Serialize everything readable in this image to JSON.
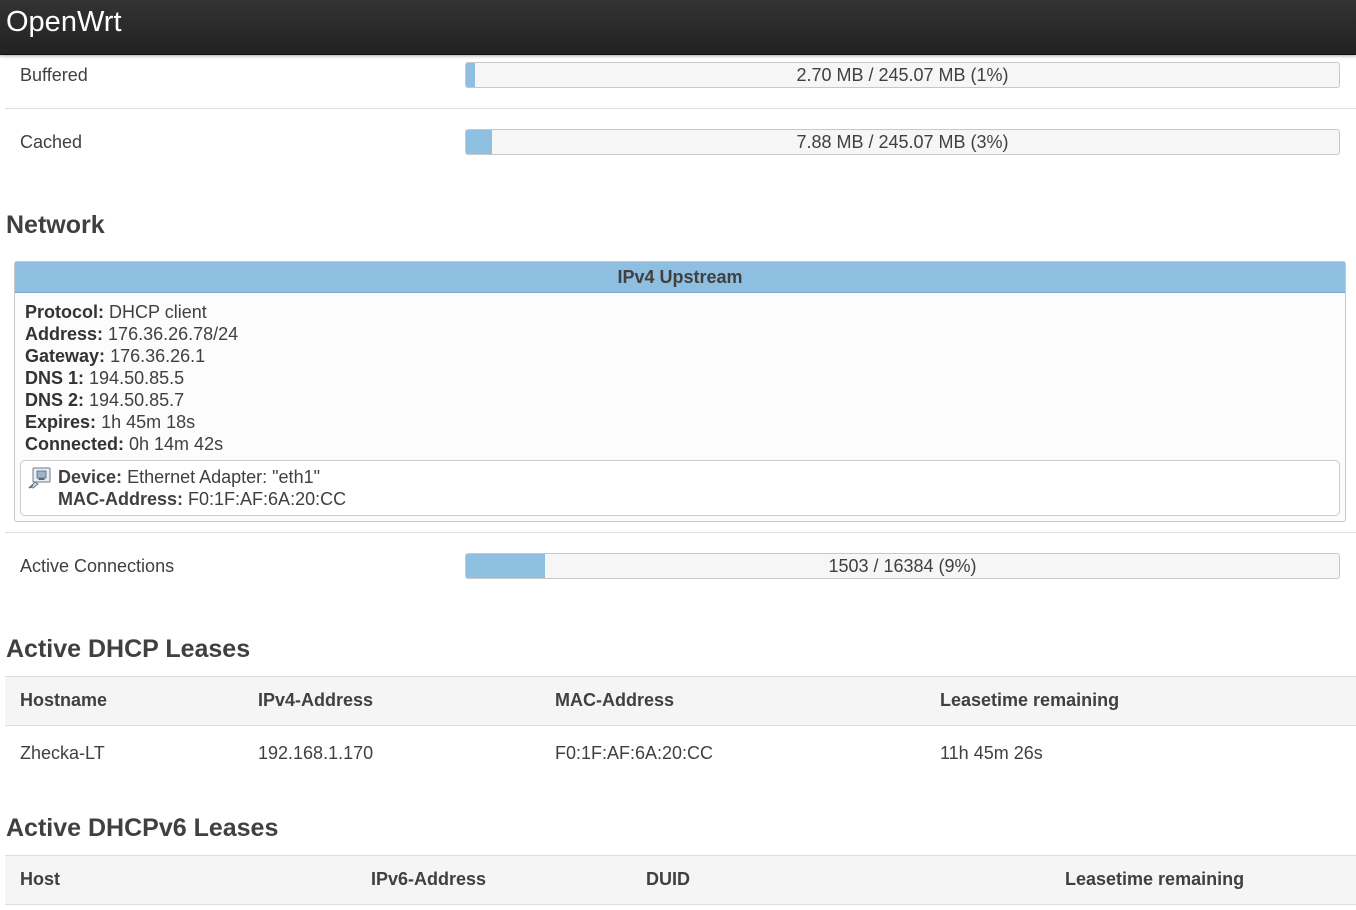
{
  "header": {
    "brand": "OpenWrt"
  },
  "memory": {
    "buffered": {
      "label": "Buffered",
      "text": "2.70 MB / 245.07 MB (1%)",
      "percent": 1
    },
    "cached": {
      "label": "Cached",
      "text": "7.88 MB / 245.07 MB (3%)",
      "percent": 3
    }
  },
  "network": {
    "title": "Network",
    "upstream": {
      "title": "IPv4 Upstream",
      "fields": [
        {
          "key": "Protocol:",
          "value": "DHCP client"
        },
        {
          "key": "Address:",
          "value": "176.36.26.78/24"
        },
        {
          "key": "Gateway:",
          "value": "176.36.26.1"
        },
        {
          "key": "DNS 1:",
          "value": "194.50.85.5"
        },
        {
          "key": "DNS 2:",
          "value": "194.50.85.7"
        },
        {
          "key": "Expires:",
          "value": "1h 45m 18s"
        },
        {
          "key": "Connected:",
          "value": "0h 14m 42s"
        }
      ],
      "device": {
        "icon": "ethernet-port-icon",
        "device_key": "Device:",
        "device_value": "Ethernet Adapter: \"eth1\"",
        "mac_key": "MAC-Address:",
        "mac_value": "F0:1F:AF:6A:20:CC"
      }
    },
    "active_connections": {
      "label": "Active Connections",
      "text": "1503 / 16384 (9%)",
      "percent": 9
    }
  },
  "dhcp": {
    "title": "Active DHCP Leases",
    "columns": [
      "Hostname",
      "IPv4-Address",
      "MAC-Address",
      "Leasetime remaining"
    ],
    "rows": [
      [
        "Zhecka-LT",
        "192.168.1.170",
        "F0:1F:AF:6A:20:CC",
        "11h 45m 26s"
      ]
    ]
  },
  "dhcpv6": {
    "title": "Active DHCPv6 Leases",
    "columns": [
      "Host",
      "IPv6-Address",
      "DUID",
      "Leasetime remaining"
    ]
  },
  "colors": {
    "topbar": "#222222",
    "progress_fill": "#8fbfe0",
    "header_band": "#8fbfe0"
  }
}
